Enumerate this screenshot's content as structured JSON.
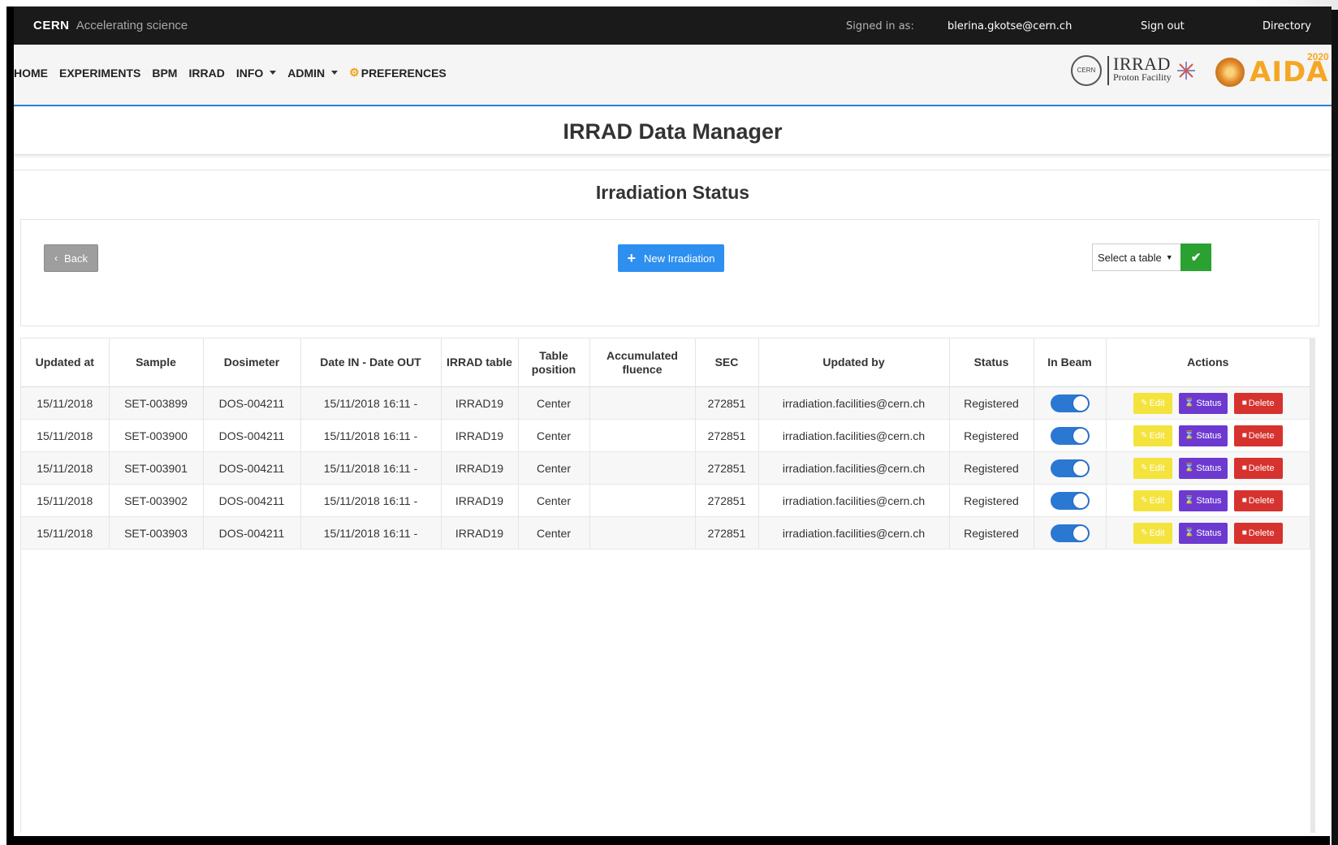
{
  "topbar": {
    "brand_name": "CERN",
    "brand_tagline": "Accelerating science",
    "signed_in_label": "Signed in as:",
    "user_email": "blerina.gkotse@cern.ch",
    "sign_out": "Sign out",
    "directory": "Directory"
  },
  "nav": {
    "items": [
      {
        "label": "HOME",
        "dropdown": false
      },
      {
        "label": "EXPERIMENTS",
        "dropdown": false
      },
      {
        "label": "BPM",
        "dropdown": false
      },
      {
        "label": "IRRAD",
        "dropdown": false
      },
      {
        "label": "INFO",
        "dropdown": true
      },
      {
        "label": "ADMIN",
        "dropdown": true
      }
    ],
    "preferences": "PREFERENCES",
    "logos": {
      "cern": "CERN",
      "irrad": "IRRAD",
      "irrad_sub": "Proton Facility",
      "aida": "AIDA",
      "aida_year": "2020"
    }
  },
  "page": {
    "title": "IRRAD Data Manager",
    "section_title": "Irradiation Status"
  },
  "controls": {
    "back": "Back",
    "new_irradiation": "New Irradiation",
    "select_table": "Select a table"
  },
  "table": {
    "headers": [
      "Updated at",
      "Sample",
      "Dosimeter",
      "Date IN - Date OUT",
      "IRRAD table",
      "Table position",
      "Accumulated fluence",
      "SEC",
      "Updated by",
      "Status",
      "In Beam",
      "Actions"
    ],
    "action_labels": {
      "edit": "Edit",
      "status": "Status",
      "delete": "Delete"
    },
    "rows": [
      {
        "updated_at": "15/11/2018",
        "sample": "SET-003899",
        "dosimeter": "DOS-004211",
        "dates": "15/11/2018 16:11 -",
        "irrad_table": "IRRAD19",
        "position": "Center",
        "fluence": "",
        "sec": "272851",
        "updated_by": "irradiation.facilities@cern.ch",
        "status": "Registered",
        "in_beam": true
      },
      {
        "updated_at": "15/11/2018",
        "sample": "SET-003900",
        "dosimeter": "DOS-004211",
        "dates": "15/11/2018 16:11 -",
        "irrad_table": "IRRAD19",
        "position": "Center",
        "fluence": "",
        "sec": "272851",
        "updated_by": "irradiation.facilities@cern.ch",
        "status": "Registered",
        "in_beam": true
      },
      {
        "updated_at": "15/11/2018",
        "sample": "SET-003901",
        "dosimeter": "DOS-004211",
        "dates": "15/11/2018 16:11 -",
        "irrad_table": "IRRAD19",
        "position": "Center",
        "fluence": "",
        "sec": "272851",
        "updated_by": "irradiation.facilities@cern.ch",
        "status": "Registered",
        "in_beam": true
      },
      {
        "updated_at": "15/11/2018",
        "sample": "SET-003902",
        "dosimeter": "DOS-004211",
        "dates": "15/11/2018 16:11 -",
        "irrad_table": "IRRAD19",
        "position": "Center",
        "fluence": "",
        "sec": "272851",
        "updated_by": "irradiation.facilities@cern.ch",
        "status": "Registered",
        "in_beam": true
      },
      {
        "updated_at": "15/11/2018",
        "sample": "SET-003903",
        "dosimeter": "DOS-004211",
        "dates": "15/11/2018 16:11 -",
        "irrad_table": "IRRAD19",
        "position": "Center",
        "fluence": "",
        "sec": "272851",
        "updated_by": "irradiation.facilities@cern.ch",
        "status": "Registered",
        "in_beam": true
      }
    ]
  },
  "colors": {
    "topbar": "#1a1a1a",
    "nav_border": "#2c7ed8",
    "primary": "#2d8ff0",
    "success": "#2aa130",
    "edit": "#f4e33c",
    "status": "#6c3ad0",
    "delete": "#d6322e",
    "toggle_on": "#2a78d2"
  }
}
